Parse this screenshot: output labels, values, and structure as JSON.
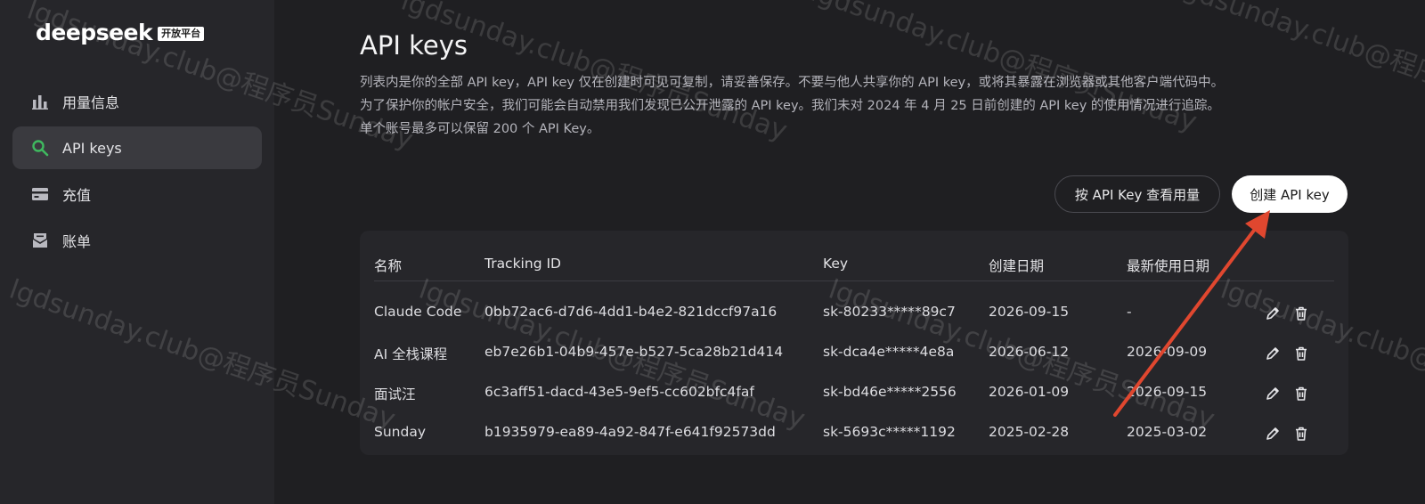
{
  "brand": {
    "logo_text": "deepseek",
    "badge": "开放平台"
  },
  "sidebar": {
    "items": [
      {
        "label": "用量信息",
        "icon": "bar-chart-icon"
      },
      {
        "label": "API keys",
        "icon": "search-key-icon",
        "active": true
      },
      {
        "label": "充值",
        "icon": "card-icon"
      },
      {
        "label": "账单",
        "icon": "bill-icon"
      }
    ]
  },
  "main": {
    "title": "API keys",
    "description": [
      "列表内是你的全部 API key，API key 仅在创建时可见可复制，请妥善保存。不要与他人共享你的 API key，或将其暴露在浏览器或其他客户端代码中。",
      "为了保护你的帐户安全，我们可能会自动禁用我们发现已公开泄露的 API key。我们未对 2024 年 4 月 25 日前创建的 API key 的使用情况进行追踪。",
      "单个账号最多可以保留 200 个 API Key。"
    ],
    "usage_button": "按 API Key 查看用量",
    "create_button": "创建 API key"
  },
  "table": {
    "headers": [
      "名称",
      "Tracking ID",
      "Key",
      "创建日期",
      "最新使用日期"
    ],
    "rows": [
      [
        "Claude Code",
        "0bb72ac6-d7d6-4dd1-b4e2-821dccf97a16",
        "sk-80233*****89c7",
        "2026-09-15",
        "-"
      ],
      [
        "AI 全栈课程",
        "eb7e26b1-04b9-457e-b527-5ca28b21d414",
        "sk-dca4e*****4e8a",
        "2026-06-12",
        "2026-09-09"
      ],
      [
        "面试汪",
        "6c3aff51-dacd-43e5-9ef5-cc602bfc4faf",
        "sk-bd46e*****2556",
        "2026-01-09",
        "2026-09-15"
      ],
      [
        "Sunday",
        "b1935979-ea89-4a92-847f-e641f92573dd",
        "sk-5693c*****1192",
        "2025-02-28",
        "2025-03-02"
      ]
    ]
  },
  "watermarks": [
    "lgdsunday.club@程序员Sunday"
  ],
  "colors": {
    "accent_green": "#3fb95f",
    "arrow_red": "#e0472f"
  }
}
